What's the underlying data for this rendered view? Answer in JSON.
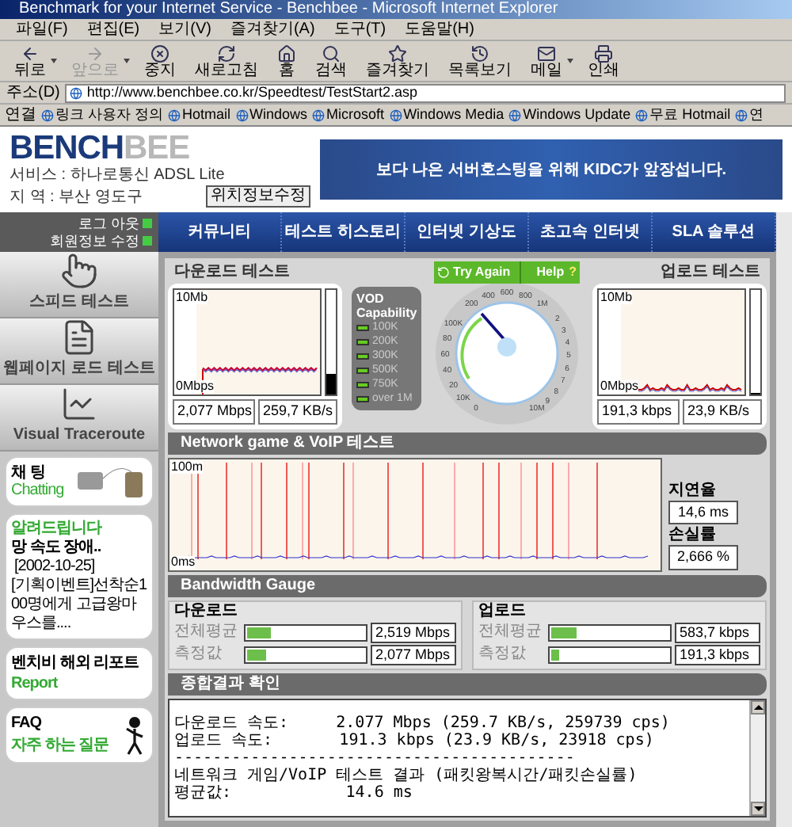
{
  "window": {
    "title": "Benchmark for your Internet Service - Benchbee - Microsoft Internet Explorer"
  },
  "menu": [
    "파일(F)",
    "편집(E)",
    "보기(V)",
    "즐겨찾기(A)",
    "도구(T)",
    "도움말(H)"
  ],
  "toolbar": [
    {
      "label": "뒤로",
      "kind": "back",
      "disabled": false,
      "dropdown": true
    },
    {
      "label": "앞으로",
      "kind": "forward",
      "disabled": true,
      "dropdown": true
    },
    {
      "label": "중지",
      "kind": "stop",
      "disabled": false,
      "dropdown": false
    },
    {
      "label": "새로고침",
      "kind": "refresh",
      "disabled": false,
      "dropdown": false
    },
    {
      "label": "홈",
      "kind": "home",
      "disabled": false,
      "dropdown": false
    },
    {
      "label": "검색",
      "kind": "search",
      "disabled": false,
      "dropdown": false
    },
    {
      "label": "즐겨찾기",
      "kind": "favorites",
      "disabled": false,
      "dropdown": false
    },
    {
      "label": "목록보기",
      "kind": "history",
      "disabled": false,
      "dropdown": false
    },
    {
      "label": "메일",
      "kind": "mail",
      "disabled": false,
      "dropdown": true
    },
    {
      "label": "인쇄",
      "kind": "print",
      "disabled": false,
      "dropdown": false
    }
  ],
  "address": {
    "label": "주소(D)",
    "url": "http://www.benchbee.co.kr/Speedtest/TestStart2.asp"
  },
  "links": {
    "label": "연결",
    "items": [
      "링크 사용자 정의",
      "Hotmail",
      "Windows",
      "Microsoft",
      "Windows Media",
      "Windows Update",
      "무료 Hotmail",
      "연"
    ]
  },
  "site_header": {
    "logo_left": "BENCH",
    "logo_right": "BEE",
    "service": "서비스 : 하나로통신 ADSL Lite",
    "region": "지 역 : 부산 영도구",
    "button": "위치정보수정",
    "banner": "보다 나은 서버호스팅을 위해 KIDC가 앞장섭니다."
  },
  "account_links": [
    "로그 아웃",
    "회원정보 수정"
  ],
  "sidebar": {
    "items": [
      {
        "label": "스피드 테스트",
        "kind": "hand"
      },
      {
        "label": "웹페이지 로드 테스트",
        "kind": "document"
      },
      {
        "label": "Visual Traceroute",
        "kind": "chart"
      }
    ]
  },
  "chat_card": {
    "title": "채 팅",
    "subtitle": "Chatting"
  },
  "notice_card": {
    "title": "알려드립니다",
    "headline": "망 속도 장애..",
    "date": "[2002-10-25]",
    "body": "[기획이벤트]선착순100명에게 고급왕마우스를...."
  },
  "report_card": {
    "title": "벤치비 해외 리포트",
    "subtitle": "Report"
  },
  "faq_card": {
    "title": "FAQ",
    "subtitle": "자주 하는 질문"
  },
  "nav_tabs": [
    "커뮤니티",
    "테스트 히스토리",
    "인터넷 기상도",
    "초고속 인터넷",
    "SLA 솔루션"
  ],
  "download_test": {
    "title": "다운로드 테스트",
    "y_max": "10Mb",
    "y_min": "0Mbps",
    "speed": "2,077 Mbps",
    "rate": "259,7 KB/s",
    "level": 0.2
  },
  "vod": {
    "title": "VOD Capability",
    "items": [
      {
        "label": "100K",
        "on": true
      },
      {
        "label": "200K",
        "on": true
      },
      {
        "label": "300K",
        "on": true
      },
      {
        "label": "500K",
        "on": true
      },
      {
        "label": "750K",
        "on": true
      },
      {
        "label": "over 1M",
        "on": true
      }
    ]
  },
  "gauge": {
    "try_again": "Try Again",
    "help": "Help",
    "help_mark": "?",
    "left_labels": [
      "100K",
      "80",
      "60",
      "40",
      "20",
      "10K",
      "0"
    ],
    "top_labels": [
      "200",
      "400",
      "600",
      "800",
      "1M"
    ],
    "right_labels": [
      "2",
      "3",
      "4",
      "5",
      "6",
      "7",
      "8",
      "9",
      "10M"
    ]
  },
  "upload_test": {
    "title": "업로드 테스트",
    "y_max": "10Mb",
    "y_min": "0Mbps",
    "speed": "191,3 kbps",
    "rate": "23,9 KB/s",
    "level": 0.02
  },
  "network_test": {
    "title": "Network game & VoIP 테스트",
    "y_max": "100m",
    "y_min": "0ms",
    "latency_label": "지연율",
    "latency": "14,6 ms",
    "loss_label": "손실률",
    "loss": "2,666 %"
  },
  "bandwidth": {
    "title": "Bandwidth Gauge",
    "groups": [
      {
        "title": "다운로드",
        "rows": [
          {
            "label": "전체평균",
            "level": 0.2,
            "value": "2,519 Mbps"
          },
          {
            "label": "측정값",
            "level": 0.16,
            "value": "2,077 Mbps"
          }
        ]
      },
      {
        "title": "업로드",
        "rows": [
          {
            "label": "전체평균",
            "level": 0.22,
            "value": "583,7 kbps"
          },
          {
            "label": "측정값",
            "level": 0.07,
            "value": "191,3 kbps"
          }
        ]
      }
    ]
  },
  "results": {
    "title": "종합결과 확인",
    "lines": [
      "다운로드 속도:     2.077 Mbps (259.7 KB/s, 259739 cps)",
      "업로드 속도:       191.3 kbps (23.9 KB/s, 23918 cps)",
      "------------------------------------------",
      "네트워크 게임/VoIP 테스트 결과 (패킷왕복시간/패킷손실률)",
      "평균값:            14.6 ms"
    ]
  }
}
